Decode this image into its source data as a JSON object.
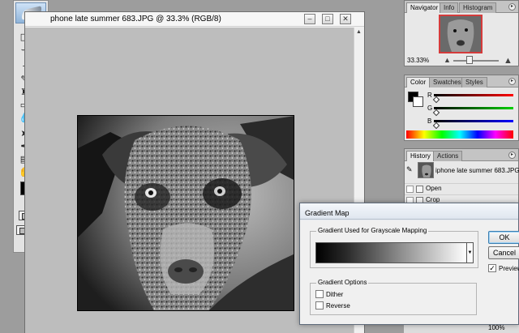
{
  "document": {
    "title": "phone late summer 683.JPG @ 33.3% (RGB/8)"
  },
  "toolbox": {
    "tools": [
      "marquee-tool",
      "move-tool",
      "lasso-tool",
      "magic-wand-tool",
      "crop-tool",
      "slice-tool",
      "healing-brush-tool",
      "brush-tool",
      "clone-stamp-tool",
      "history-brush-tool",
      "eraser-tool",
      "gradient-tool",
      "blur-tool",
      "dodge-tool",
      "path-selection-tool",
      "type-tool",
      "pen-tool",
      "shape-tool",
      "notes-tool",
      "eyedropper-tool",
      "hand-tool",
      "zoom-tool"
    ],
    "foreground_color": "#000000",
    "background_color": "#ffffff"
  },
  "navigator": {
    "tabs": [
      "Navigator",
      "Info",
      "Histogram"
    ],
    "zoom": "33.33%"
  },
  "color_panel": {
    "tabs": [
      "Color",
      "Swatches",
      "Styles"
    ],
    "channels": [
      "R",
      "G",
      "B"
    ]
  },
  "history": {
    "tabs": [
      "History",
      "Actions"
    ],
    "snapshot": "iphone late summer 683.JPG",
    "steps": [
      "Open",
      "Crop"
    ]
  },
  "status": {
    "zoom": "100%"
  },
  "dialog": {
    "title": "Gradient Map",
    "group1": "Gradient Used for Grayscale Mapping",
    "group2": "Gradient Options",
    "dither": "Dither",
    "reverse": "Reverse",
    "ok": "OK",
    "cancel": "Cancel",
    "preview": "Preview",
    "preview_checked": true
  }
}
